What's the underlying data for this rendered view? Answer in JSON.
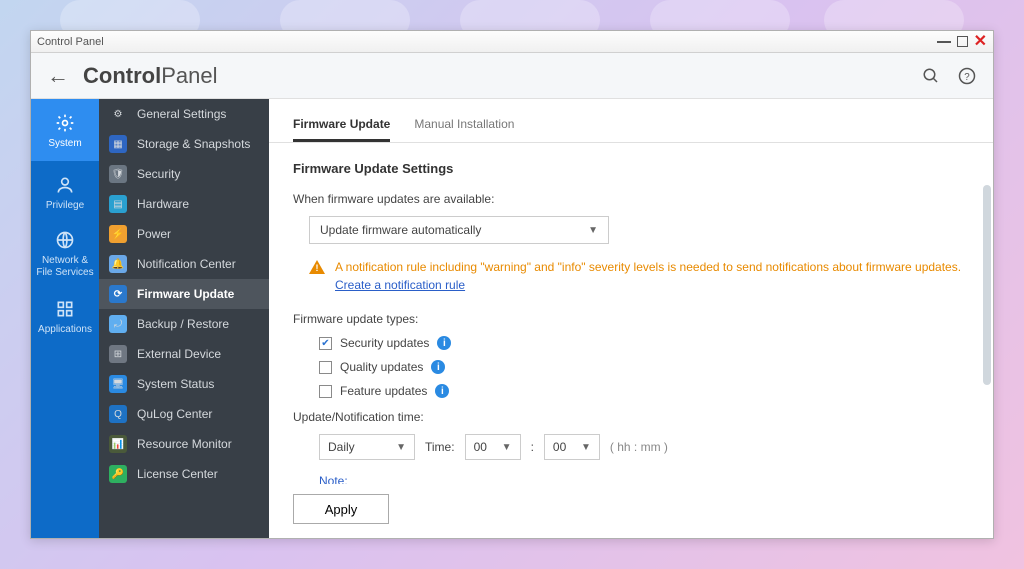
{
  "window": {
    "title": "Control Panel"
  },
  "header": {
    "title_bold": "Control",
    "title_light": "Panel"
  },
  "leftnav": {
    "items": [
      {
        "label": "System"
      },
      {
        "label": "Privilege"
      },
      {
        "label": "Network &\nFile Services"
      },
      {
        "label": "Applications"
      }
    ]
  },
  "subnav": {
    "items": [
      {
        "label": "General Settings",
        "icon_bg": "#415065"
      },
      {
        "label": "Storage & Snapshots",
        "icon_bg": "#2e66c2"
      },
      {
        "label": "Security",
        "icon_bg": "#6b7682"
      },
      {
        "label": "Hardware",
        "icon_bg": "#2aa0d0"
      },
      {
        "label": "Power",
        "icon_bg": "#f0a030"
      },
      {
        "label": "Notification Center",
        "icon_bg": "#6aa8e8"
      },
      {
        "label": "Firmware Update",
        "icon_bg": "#2a78cc"
      },
      {
        "label": "Backup / Restore",
        "icon_bg": "#60aef0"
      },
      {
        "label": "External Device",
        "icon_bg": "#6f7782"
      },
      {
        "label": "System Status",
        "icon_bg": "#2a8ae2"
      },
      {
        "label": "QuLog Center",
        "icon_bg": "#1e72c4"
      },
      {
        "label": "Resource Monitor",
        "icon_bg": "#4a5a3a"
      },
      {
        "label": "License Center",
        "icon_bg": "#2eb060"
      }
    ]
  },
  "tabs": {
    "items": [
      {
        "label": "Firmware Update"
      },
      {
        "label": "Manual Installation"
      }
    ]
  },
  "content": {
    "section_title": "Firmware Update Settings",
    "when_label": "When firmware updates are available:",
    "mode_select": "Update firmware automatically",
    "warn_text": "A notification rule including \"warning\" and \"info\" severity levels is needed to send notifications about firmware updates. ",
    "warn_link": "Create a notification rule",
    "types_label": "Firmware update types:",
    "cb_security": "Security updates",
    "cb_quality": "Quality updates",
    "cb_feature": "Feature updates",
    "time_label": "Update/Notification time:",
    "freq_select": "Daily",
    "time_word": "Time:",
    "hh_select": "00",
    "mm_select": "00",
    "hhmm_hint": "( hh : mm )",
    "note_label": "Note:"
  },
  "footer": {
    "apply": "Apply"
  }
}
